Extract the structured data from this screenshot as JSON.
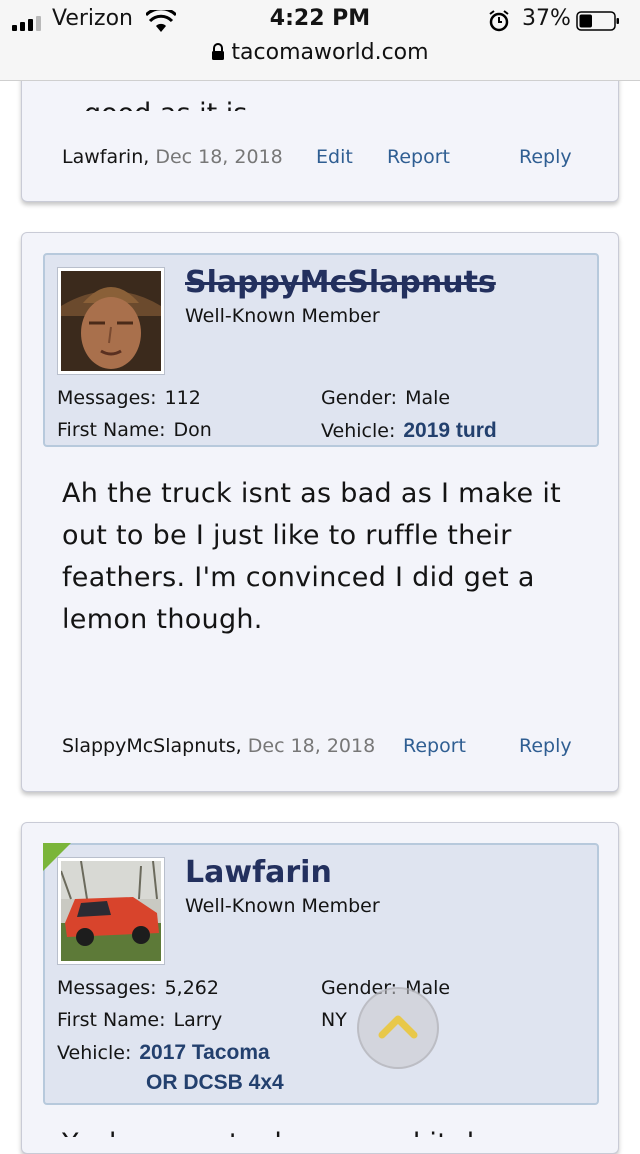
{
  "status_bar": {
    "carrier": "Verizon",
    "time": "4:22 PM",
    "battery": "37%",
    "battery_level": 0.37
  },
  "browser": {
    "url": "tacomaworld.com"
  },
  "posts": [
    {
      "partial_text": "good as it is",
      "footer": {
        "author": "Lawfarin",
        "date": "Dec 18, 2018",
        "edit": "Edit",
        "report": "Report",
        "reply": "Reply"
      }
    },
    {
      "username": "SlappyMcSlapnuts",
      "title": "Well-Known Member",
      "messages_label": "Messages:",
      "messages": "112",
      "gender_label": "Gender:",
      "gender": "Male",
      "firstname_label": "First Name:",
      "firstname": "Don",
      "vehicle_label": "Vehicle:",
      "vehicle": "2019 turd",
      "body": "Ah the truck isnt as bad as I make it out to be I just like to ruffle their feathers. I'm convinced I did get a lemon though.",
      "footer": {
        "author": "SlappyMcSlapnuts",
        "date": "Dec 18, 2018",
        "report": "Report",
        "reply": "Reply"
      }
    },
    {
      "username": "Lawfarin",
      "title": "Well-Known Member",
      "messages_label": "Messages:",
      "messages": "5,262",
      "gender_label": "Gender:",
      "gender": "Male",
      "firstname_label": "First Name:",
      "firstname": "Larry",
      "location": "NY",
      "vehicle_label": "Vehicle:",
      "vehicle_line1": "2017 Tacoma",
      "vehicle_line2": "OR DCSB 4x4",
      "body_partial": "Yeah you got a lemon and it does"
    }
  ],
  "colors": {
    "link": "#2f5e92",
    "username": "#23305e",
    "card_bg": "#f3f4fa",
    "userbox_bg": "#dfe4f0"
  },
  "icons": {
    "scroll_top": "chevron-up-icon",
    "new_badge": "new-corner-icon",
    "lock": "lock-icon"
  }
}
